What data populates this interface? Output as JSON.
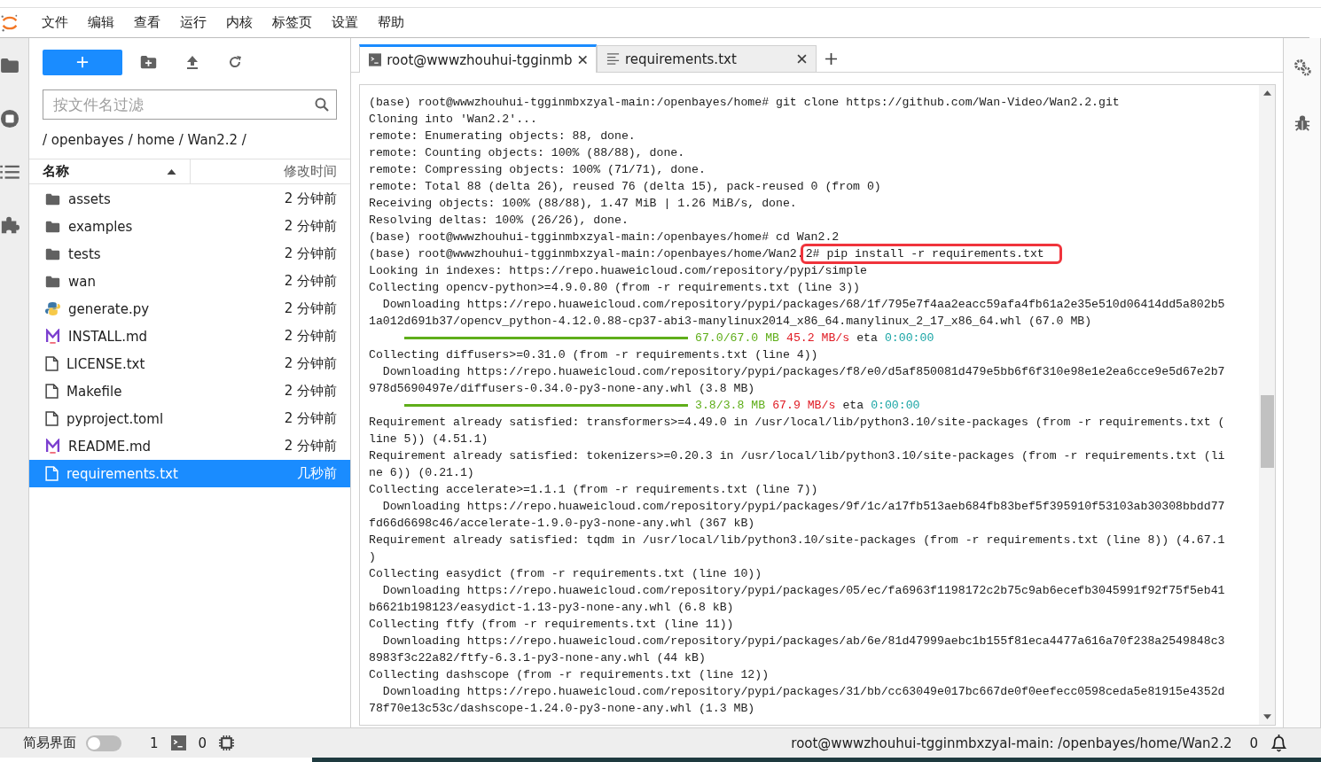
{
  "menu": [
    "文件",
    "编辑",
    "查看",
    "运行",
    "内核",
    "标签页",
    "设置",
    "帮助"
  ],
  "file_browser": {
    "filter": {
      "placeholder": "按文件名过滤"
    },
    "breadcrumb": "/ openbayes / home / Wan2.2 /",
    "columns": [
      {
        "label": "名称",
        "sorted": true
      },
      {
        "label": "修改时间",
        "sorted": false
      }
    ],
    "files": [
      {
        "kind": "folder",
        "name": "assets",
        "modified": "2 分钟前",
        "selected": false
      },
      {
        "kind": "folder",
        "name": "examples",
        "modified": "2 分钟前",
        "selected": false
      },
      {
        "kind": "folder",
        "name": "tests",
        "modified": "2 分钟前",
        "selected": false
      },
      {
        "kind": "folder",
        "name": "wan",
        "modified": "2 分钟前",
        "selected": false
      },
      {
        "kind": "python",
        "name": "generate.py",
        "modified": "2 分钟前",
        "selected": false
      },
      {
        "kind": "markdown",
        "name": "INSTALL.md",
        "modified": "2 分钟前",
        "selected": false
      },
      {
        "kind": "file",
        "name": "LICENSE.txt",
        "modified": "2 分钟前",
        "selected": false
      },
      {
        "kind": "file",
        "name": "Makefile",
        "modified": "2 分钟前",
        "selected": false
      },
      {
        "kind": "file",
        "name": "pyproject.toml",
        "modified": "2 分钟前",
        "selected": false
      },
      {
        "kind": "markdown",
        "name": "README.md",
        "modified": "2 分钟前",
        "selected": false
      },
      {
        "kind": "file",
        "name": "requirements.txt",
        "modified": "几秒前",
        "selected": true
      }
    ]
  },
  "tabs": [
    {
      "kind": "terminal",
      "label": "root@wwwzhouhui-tgginmb",
      "selected": true
    },
    {
      "kind": "text",
      "label": "requirements.txt",
      "selected": false
    }
  ],
  "terminal": {
    "lines": [
      {
        "kind": "text",
        "text": "(base) root@wwwzhouhui-tgginmbxzyal-main:/openbayes/home# git clone https://github.com/Wan-Video/Wan2.2.git"
      },
      {
        "kind": "text",
        "text": "Cloning into 'Wan2.2'..."
      },
      {
        "kind": "text",
        "text": "remote: Enumerating objects: 88, done."
      },
      {
        "kind": "text",
        "text": "remote: Counting objects: 100% (88/88), done."
      },
      {
        "kind": "text",
        "text": "remote: Compressing objects: 100% (71/71), done."
      },
      {
        "kind": "text",
        "text": "remote: Total 88 (delta 26), reused 76 (delta 15), pack-reused 0 (from 0)"
      },
      {
        "kind": "text",
        "text": "Receiving objects: 100% (88/88), 1.47 MiB | 1.26 MiB/s, done."
      },
      {
        "kind": "text",
        "text": "Resolving deltas: 100% (26/26), done."
      },
      {
        "kind": "text",
        "text": "(base) root@wwwzhouhui-tgginmbxzyal-main:/openbayes/home# cd Wan2.2"
      },
      {
        "kind": "highlighted",
        "text": "(base) root@wwwzhouhui-tgginmbxzyal-main:/openbayes/home/Wan2.",
        "highlight": "2# pip install -r requirements.txt"
      },
      {
        "kind": "text",
        "text": "Looking in indexes: https://repo.huaweicloud.com/repository/pypi/simple"
      },
      {
        "kind": "text",
        "text": "Collecting opencv-python>=4.9.0.80 (from -r requirements.txt (line 3))"
      },
      {
        "kind": "text",
        "text": "  Downloading https://repo.huaweicloud.com/repository/pypi/packages/68/1f/795e7f4aa2eacc59afa4fb61a2e35e510d06414dd5a802b5"
      },
      {
        "kind": "text",
        "text": "1a012d691b37/opencv_python-4.12.0.88-cp37-abi3-manylinux2014_x86_64.manylinux_2_17_x86_64.whl (67.0 MB)"
      },
      {
        "kind": "progress",
        "level": 1,
        "size": "67.0/67.0 MB",
        "speed": "45.2 MB/s",
        "eta_label": "eta",
        "eta": "0:00:00"
      },
      {
        "kind": "text",
        "text": "Collecting diffusers>=0.31.0 (from -r requirements.txt (line 4))"
      },
      {
        "kind": "text",
        "text": "  Downloading https://repo.huaweicloud.com/repository/pypi/packages/f8/e0/d5af850081d479e5bb6f6f310e98e1e2ea6cce9e5d67e2b7"
      },
      {
        "kind": "text",
        "text": "978d5690497e/diffusers-0.34.0-py3-none-any.whl (3.8 MB)"
      },
      {
        "kind": "progress",
        "level": 1,
        "size": "3.8/3.8 MB",
        "speed": "67.9 MB/s",
        "eta_label": "eta",
        "eta": "0:00:00"
      },
      {
        "kind": "text",
        "text": "Requirement already satisfied: transformers>=4.49.0 in /usr/local/lib/python3.10/site-packages (from -r requirements.txt ("
      },
      {
        "kind": "text",
        "text": "line 5)) (4.51.1)"
      },
      {
        "kind": "text",
        "text": "Requirement already satisfied: tokenizers>=0.20.3 in /usr/local/lib/python3.10/site-packages (from -r requirements.txt (li"
      },
      {
        "kind": "text",
        "text": "ne 6)) (0.21.1)"
      },
      {
        "kind": "text",
        "text": "Collecting accelerate>=1.1.1 (from -r requirements.txt (line 7))"
      },
      {
        "kind": "text",
        "text": "  Downloading https://repo.huaweicloud.com/repository/pypi/packages/9f/1c/a17fb513aeb684fb83bef5f395910f53103ab30308bbdd77"
      },
      {
        "kind": "text",
        "text": "fd66d6698c46/accelerate-1.9.0-py3-none-any.whl (367 kB)"
      },
      {
        "kind": "text",
        "text": "Requirement already satisfied: tqdm in /usr/local/lib/python3.10/site-packages (from -r requirements.txt (line 8)) (4.67.1"
      },
      {
        "kind": "text",
        "text": ")"
      },
      {
        "kind": "text",
        "text": "Collecting easydict (from -r requirements.txt (line 10))"
      },
      {
        "kind": "text",
        "text": "  Downloading https://repo.huaweicloud.com/repository/pypi/packages/05/ec/fa6963f1198172c2b75c9ab6ecefb3045991f92f75f5eb41"
      },
      {
        "kind": "text",
        "text": "b6621b198123/easydict-1.13-py3-none-any.whl (6.8 kB)"
      },
      {
        "kind": "text",
        "text": "Collecting ftfy (from -r requirements.txt (line 11))"
      },
      {
        "kind": "text",
        "text": "  Downloading https://repo.huaweicloud.com/repository/pypi/packages/ab/6e/81d47999aebc1b155f81eca4477a616a70f238a2549848c3"
      },
      {
        "kind": "text",
        "text": "8983f3c22a82/ftfy-6.3.1-py3-none-any.whl (44 kB)"
      },
      {
        "kind": "text",
        "text": "Collecting dashscope (from -r requirements.txt (line 12))"
      },
      {
        "kind": "text",
        "text": "  Downloading https://repo.huaweicloud.com/repository/pypi/packages/31/bb/cc63049e017bc667de0f0eefecc0598ceda5e81915e4352d"
      },
      {
        "kind": "text",
        "text": "78f70e13c53c/dashscope-1.24.0-py3-none-any.whl (1.3 MB)"
      }
    ]
  },
  "status_bar": {
    "simple_mode": {
      "label": "简易界面",
      "on": false
    },
    "terminals": "1",
    "kernels": "0",
    "path": "root@wwwzhouhui-tgginmbxzyal-main: /openbayes/home/Wan2.2",
    "notifications": "0"
  }
}
